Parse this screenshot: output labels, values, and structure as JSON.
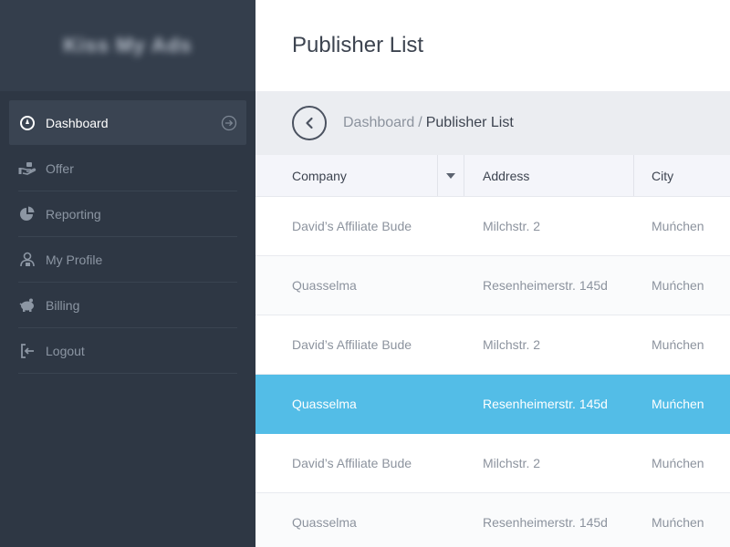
{
  "brand": {
    "name": "Kiss My Ads"
  },
  "sidebar": {
    "items": [
      {
        "label": "Dashboard",
        "icon": "dashboard-icon",
        "active": true
      },
      {
        "label": "Offer",
        "icon": "hand-offer-icon"
      },
      {
        "label": "Reporting",
        "icon": "pie-chart-icon"
      },
      {
        "label": "My Profile",
        "icon": "profile-icon"
      },
      {
        "label": "Billing",
        "icon": "piggy-bank-icon"
      },
      {
        "label": "Logout",
        "icon": "logout-icon"
      }
    ]
  },
  "page": {
    "title": "Publisher List"
  },
  "breadcrumb": {
    "parent": "Dashboard",
    "separator": "/",
    "current": "Publisher List"
  },
  "table": {
    "columns": [
      "Company",
      "Address",
      "City"
    ],
    "rows": [
      {
        "company": "David’s Affiliate Bude",
        "address": "Milchstr. 2",
        "city": "Muńchen"
      },
      {
        "company": "Quasselma",
        "address": "Resenheimerstr. 145d",
        "city": "Muńchen"
      },
      {
        "company": "David’s Affiliate Bude",
        "address": "Milchstr. 2",
        "city": "Muńchen"
      },
      {
        "company": "Quasselma",
        "address": "Resenheimerstr. 145d",
        "city": "Muńchen",
        "selected": true
      },
      {
        "company": "David’s Affiliate Bude",
        "address": "Milchstr. 2",
        "city": "Muńchen"
      },
      {
        "company": "Quasselma",
        "address": "Resenheimerstr. 145d",
        "city": "Muńchen"
      }
    ]
  },
  "colors": {
    "sidebar_bg": "#2e3744",
    "accent_selected": "#53bde7",
    "breadcrumb_bg": "#ebedf1"
  }
}
